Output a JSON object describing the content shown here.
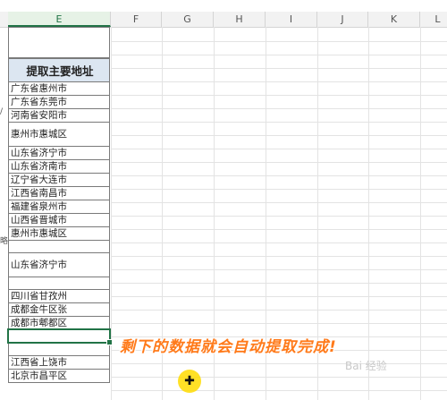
{
  "columns": [
    "E",
    "F",
    "G",
    "H",
    "I",
    "J",
    "K",
    "L"
  ],
  "header": "提取主要地址",
  "cells": [
    "广东省惠州市",
    "广东省东莞市",
    "河南省安阳市",
    "惠州市惠城区",
    "山东省济宁市",
    "山东省济南市",
    "辽宁省大连市",
    "江西省南昌市",
    "福建省泉州市",
    "山西省晋城市",
    "惠州市惠城区",
    "",
    "山东省济宁市",
    "",
    "四川省甘孜州",
    "成都金牛区张",
    "成都市郫都区",
    "",
    "",
    "江西省上饶市",
    "北京市昌平区"
  ],
  "caption": "剩下的数据就会自动提取完成!",
  "watermark": "Bai 经验",
  "colors": {
    "accent": "#217346",
    "caption": "#ff7a1a",
    "header_fill": "#dce6f1"
  },
  "icons": {
    "cursor": "cell-select-cursor-icon"
  }
}
